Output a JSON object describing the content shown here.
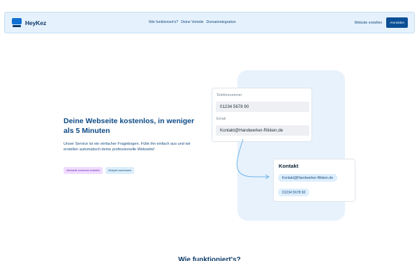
{
  "nav": {
    "logo_text": "HeyKez",
    "links": [
      "Wie funktioniert's?",
      "Deine Vorteile",
      "Domainintegration"
    ],
    "create_label": "Website erstellen",
    "login_label": "Anmelden"
  },
  "hero": {
    "title": "Deine Webseite kostenlos, in weniger als 5 Minuten",
    "text": "Unser Service ist ein einfacher Fragebogen. Fülle ihn einfach aus und wir erstellen automatisch deine professionelle Webseite!",
    "primary_cta": "Webseite kostenlos erstellen",
    "secondary_cta": "Beispiel anschauen"
  },
  "form_card": {
    "phone_label": "Telefonnummer",
    "phone_value": "01234 5678 90",
    "email_label": "Email",
    "email_value": "Kontakt@Handwerker-Rikken.de"
  },
  "contact_card": {
    "title": "Kontakt",
    "email": "Kontakt@Handwerker-Rikken.de",
    "phone": "01234 5678 90"
  },
  "section": {
    "heading": "Wie funktioniert's?"
  },
  "colors": {
    "accent": "#0b4f96",
    "navbar_bg": "#e5f1fc",
    "blob_bg": "#e8f2fc",
    "primary_cta_bg": "#f0dcff",
    "connector": "#6fb4e8"
  }
}
